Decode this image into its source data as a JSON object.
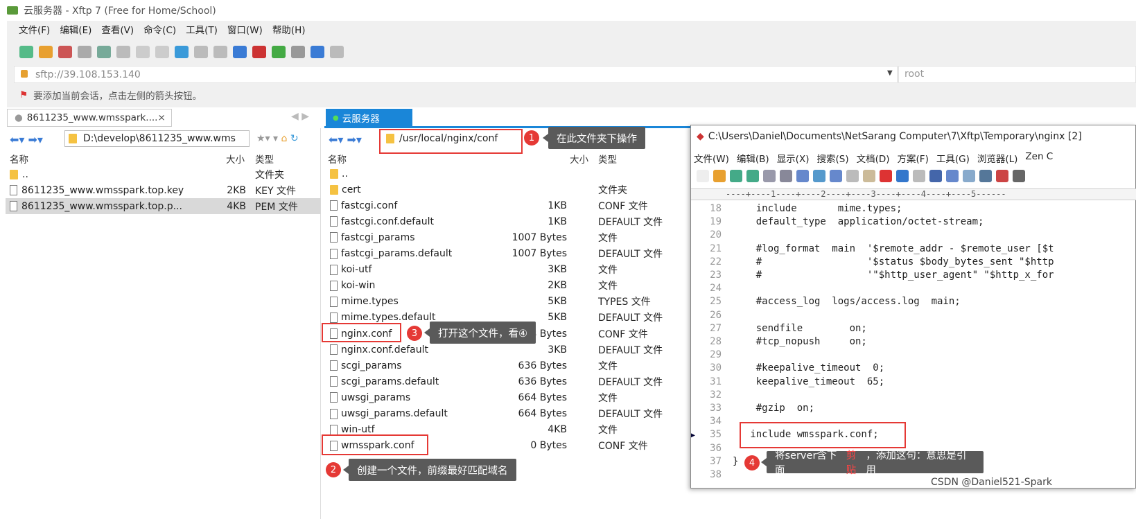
{
  "window": {
    "title": "云服务器 - Xftp 7 (Free for Home/School)"
  },
  "menu": [
    "文件(F)",
    "编辑(E)",
    "查看(V)",
    "命令(C)",
    "工具(T)",
    "窗口(W)",
    "帮助(H)"
  ],
  "address": {
    "value": "sftp://39.108.153.140",
    "user": "root"
  },
  "info": "要添加当前会话，点击左侧的箭头按钮。",
  "left_pane": {
    "tab": "8611235_www.wmsspark....",
    "path": "D:\\develop\\8611235_www.wms",
    "columns": [
      "名称",
      "大小",
      "类型"
    ],
    "files": [
      {
        "name": "..",
        "size": "",
        "type": "文件夹"
      },
      {
        "name": "8611235_www.wmsspark.top.key",
        "size": "2KB",
        "type": "KEY 文件"
      },
      {
        "name": "8611235_www.wmsspark.top.p...",
        "size": "4KB",
        "type": "PEM 文件"
      }
    ]
  },
  "right_pane": {
    "tab": "云服务器",
    "path": "/usr/local/nginx/conf",
    "columns": [
      "名称",
      "大小",
      "类型"
    ],
    "files": [
      {
        "name": "..",
        "size": "",
        "type": ""
      },
      {
        "name": "cert",
        "size": "",
        "type": "文件夹"
      },
      {
        "name": "fastcgi.conf",
        "size": "1KB",
        "type": "CONF 文件"
      },
      {
        "name": "fastcgi.conf.default",
        "size": "1KB",
        "type": "DEFAULT 文件"
      },
      {
        "name": "fastcgi_params",
        "size": "1007 Bytes",
        "type": "文件"
      },
      {
        "name": "fastcgi_params.default",
        "size": "1007 Bytes",
        "type": "DEFAULT 文件"
      },
      {
        "name": "koi-utf",
        "size": "3KB",
        "type": "文件"
      },
      {
        "name": "koi-win",
        "size": "2KB",
        "type": "文件"
      },
      {
        "name": "mime.types",
        "size": "5KB",
        "type": "TYPES 文件"
      },
      {
        "name": "mime.types.default",
        "size": "5KB",
        "type": "DEFAULT 文件"
      },
      {
        "name": "nginx.conf",
        "size": "698 Bytes",
        "type": "CONF 文件"
      },
      {
        "name": "nginx.conf.default",
        "size": "3KB",
        "type": "DEFAULT 文件"
      },
      {
        "name": "scgi_params",
        "size": "636 Bytes",
        "type": "文件"
      },
      {
        "name": "scgi_params.default",
        "size": "636 Bytes",
        "type": "DEFAULT 文件"
      },
      {
        "name": "uwsgi_params",
        "size": "664 Bytes",
        "type": "文件"
      },
      {
        "name": "uwsgi_params.default",
        "size": "664 Bytes",
        "type": "DEFAULT 文件"
      },
      {
        "name": "win-utf",
        "size": "4KB",
        "type": "文件"
      },
      {
        "name": "wmsspark.conf",
        "size": "0 Bytes",
        "type": "CONF 文件"
      }
    ]
  },
  "editor": {
    "title": "C:\\Users\\Daniel\\Documents\\NetSarang Computer\\7\\Xftp\\Temporary\\nginx [2]",
    "menu": [
      "文件(W)",
      "编辑(B)",
      "显示(X)",
      "搜索(S)",
      "文档(D)",
      "方案(F)",
      "工具(G)",
      "浏览器(L)",
      "Zen C"
    ],
    "ruler": "----+----1----+----2----+----3----+----4----+----5------",
    "lines": [
      [
        "18",
        "    include       mime.types;"
      ],
      [
        "19",
        "    default_type  application/octet-stream;"
      ],
      [
        "20",
        ""
      ],
      [
        "21",
        "    #log_format  main  '$remote_addr - $remote_user [$t"
      ],
      [
        "22",
        "    #                  '$status $body_bytes_sent \"$http"
      ],
      [
        "23",
        "    #                  '\"$http_user_agent\" \"$http_x_for"
      ],
      [
        "24",
        ""
      ],
      [
        "25",
        "    #access_log  logs/access.log  main;"
      ],
      [
        "26",
        ""
      ],
      [
        "27",
        "    sendfile        on;"
      ],
      [
        "28",
        "    #tcp_nopush     on;"
      ],
      [
        "29",
        ""
      ],
      [
        "30",
        "    #keepalive_timeout  0;"
      ],
      [
        "31",
        "    keepalive_timeout  65;"
      ],
      [
        "32",
        ""
      ],
      [
        "33",
        "    #gzip  on;"
      ],
      [
        "34",
        ""
      ],
      [
        "35",
        "   include wmsspark.conf;"
      ],
      [
        "36",
        ""
      ],
      [
        "37",
        "}"
      ],
      [
        "38",
        ""
      ]
    ]
  },
  "annotations": [
    {
      "n": "1",
      "text": "在此文件夹下操作"
    },
    {
      "n": "2",
      "text": "创建一个文件，前缀最好匹配域名"
    },
    {
      "n": "3",
      "text": "打开这个文件，看④"
    },
    {
      "n": "4",
      "pre": "将server含下面",
      "highlight": "剪贴",
      "post": "，添加这句：意思是引用"
    }
  ],
  "watermark": "CSDN @Daniel521-Spark"
}
